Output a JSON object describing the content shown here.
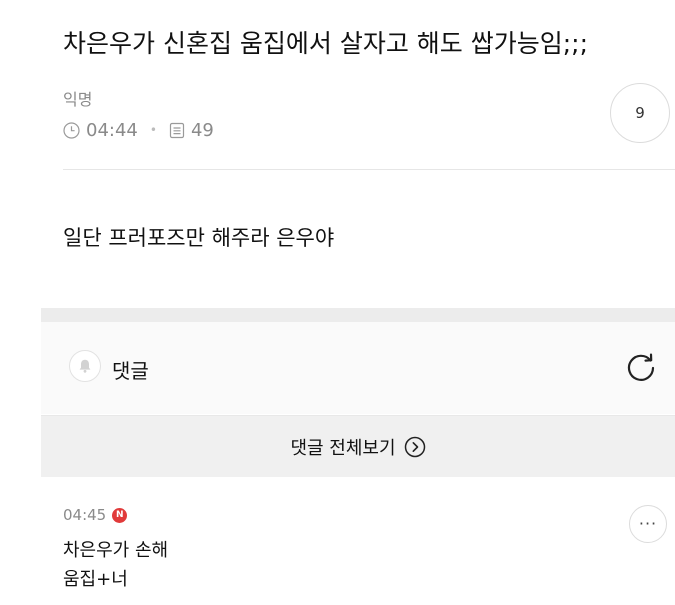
{
  "post": {
    "title": "차은우가 신혼집 움집에서 살자고 해도 쌉가능임;;;",
    "author": "익명",
    "time": "04:44",
    "views": "49",
    "comment_count": "9",
    "body": "일단 프러포즈만 해주라 은우야"
  },
  "comments_section": {
    "label": "댓글",
    "view_all_label": "댓글 전체보기"
  },
  "comments": [
    {
      "time": "04:45",
      "badge": "N",
      "line1": "차은우가 손해",
      "line2": "움집+너",
      "more_label": "···"
    }
  ],
  "icons": {
    "clock": "clock-icon",
    "views": "document-icon",
    "bell": "bell-icon",
    "refresh": "refresh-icon",
    "view_all_arrow": "chevron-right-circle-icon",
    "more": "more-icon"
  },
  "colors": {
    "new_badge": "#e13a3a",
    "meta_text": "#8a8a8a"
  }
}
